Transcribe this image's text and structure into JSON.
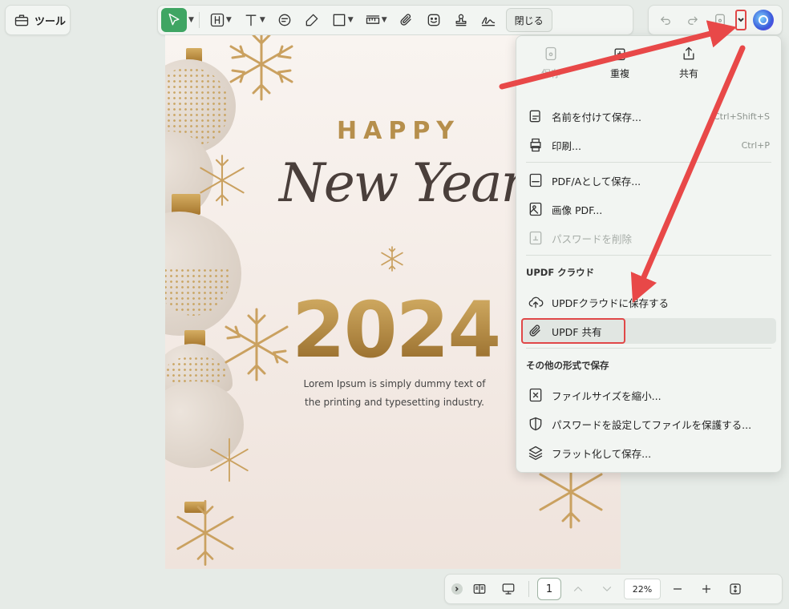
{
  "tools": {
    "label": "ツール"
  },
  "toolbar": {
    "close_label": "閉じる"
  },
  "menu": {
    "top_items": [
      {
        "label": "保存",
        "icon": "save-icon"
      },
      {
        "label": "重複",
        "icon": "duplicate-icon"
      },
      {
        "label": "共有",
        "icon": "share-icon"
      }
    ],
    "save_as": {
      "label": "名前を付けて保存...",
      "shortcut": "Ctrl+Shift+S"
    },
    "print": {
      "label": "印刷...",
      "shortcut": "Ctrl+P"
    },
    "save_pdfa": {
      "label": "PDF/Aとして保存..."
    },
    "image_pdf": {
      "label": "画像 PDF..."
    },
    "remove_password": {
      "label": "パスワードを削除"
    },
    "cloud_heading": "UPDF クラウド",
    "save_cloud": {
      "label": "UPDFクラウドに保存する"
    },
    "updf_share": {
      "label": "UPDF 共有"
    },
    "other_heading": "その他の形式で保存",
    "reduce_size": {
      "label": "ファイルサイズを縮小..."
    },
    "protect": {
      "label": "パスワードを設定してファイルを保護する..."
    },
    "flatten": {
      "label": "フラット化して保存..."
    }
  },
  "document": {
    "happy": "HAPPY",
    "new_year": "New Year!",
    "year": "2024",
    "body": "Lorem Ipsum is simply dummy text of the printing and typesetting industry."
  },
  "bottom": {
    "page": "1",
    "zoom": "22%"
  },
  "colors": {
    "accent": "#3fa563",
    "highlight_red": "#e04848",
    "gold": "#b68f4c"
  }
}
